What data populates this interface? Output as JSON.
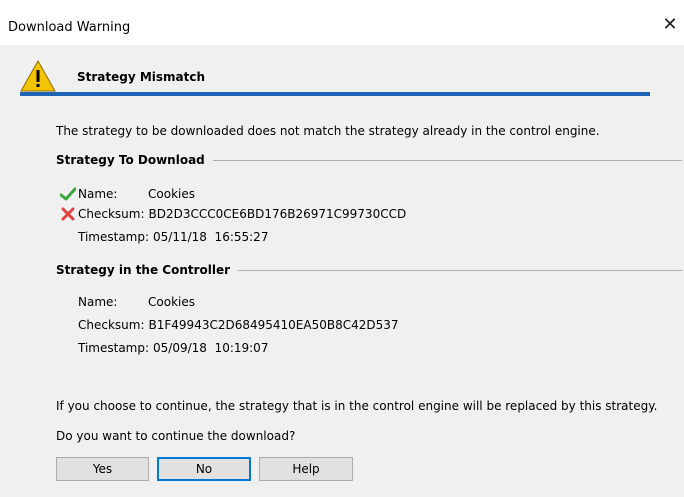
{
  "window": {
    "title": "Download Warning"
  },
  "header": {
    "title": "Strategy Mismatch"
  },
  "message": "The strategy to be downloaded does not match the strategy already in the control engine.",
  "download": {
    "heading": "Strategy To Download",
    "name_label": "Name:",
    "name": "Cookies",
    "checksum_label": "Checksum:",
    "checksum": "BD2D3CCC0CE6BD176B26971C99730CCD",
    "timestamp_label": "Timestamp:",
    "timestamp": "05/11/18  16:55:27"
  },
  "controller": {
    "heading": "Strategy in the Controller",
    "name_label": "Name:",
    "name": "Cookies",
    "checksum_label": "Checksum:",
    "checksum": "B1F49943C2D68495410EA50B8C42D537",
    "timestamp_label": "Timestamp:",
    "timestamp": "05/09/18  10:19:07"
  },
  "replace_note": "If you choose to continue, the strategy that is in the control engine will be replaced by this strategy.",
  "question": "Do you want to continue the download?",
  "buttons": {
    "yes": "Yes",
    "no": "No",
    "help": "Help"
  },
  "colors": {
    "accent_rule": "#1f63b6",
    "check_green": "#3aa53a",
    "cross_red": "#e04040",
    "warning_yellow": "#f5c400"
  }
}
